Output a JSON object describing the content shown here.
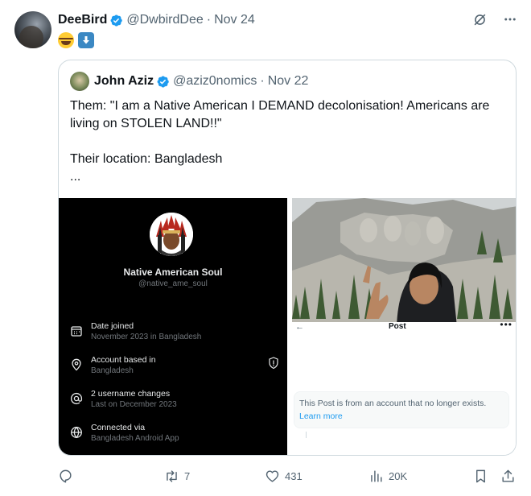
{
  "author": {
    "name": "DeeBird",
    "handle": "@DwbirdDee",
    "date": "Nov 24"
  },
  "reaction_emojis": [
    "face-with-tears-of-joy",
    "down-arrow"
  ],
  "quoted": {
    "name": "John Aziz",
    "handle": "@aziz0nomics",
    "date": "Nov 22",
    "text_lines": [
      "Them: \"I am a Native American I DEMAND decolonisation! Americans are living on STOLEN LAND!!\"",
      "Their location: Bangladesh",
      "..."
    ],
    "media_left": {
      "profile_name": "Native American Soul",
      "profile_handle": "@native_ame_soul",
      "rows": [
        {
          "icon": "calendar-icon",
          "title": "Date joined",
          "value": "November 2023 in Bangladesh"
        },
        {
          "icon": "location-pin-icon",
          "title": "Account based in",
          "value": "Bangladesh"
        },
        {
          "icon": "at-sign-icon",
          "title": "2 username changes",
          "value": "Last on December 2023"
        },
        {
          "icon": "globe-icon",
          "title": "Connected via",
          "value": "Bangladesh Android App"
        }
      ]
    },
    "media_right": {
      "post_label": "Post",
      "notice_text": "This Post is from an account that no longer exists.",
      "notice_link": "Learn more"
    }
  },
  "actions": {
    "retweets": "7",
    "likes": "431",
    "views": "20K"
  },
  "colors": {
    "accent": "#1d9bf0",
    "muted": "#536471",
    "border": "#cfd9de"
  }
}
